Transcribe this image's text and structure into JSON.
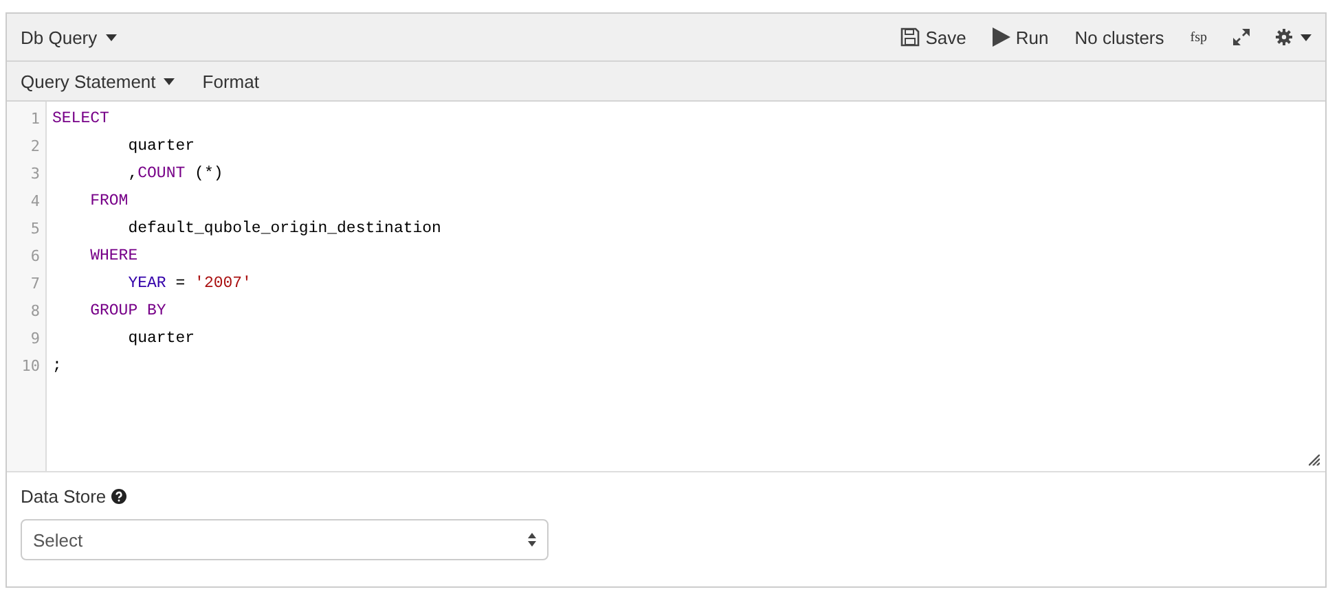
{
  "header": {
    "title": "Db Query",
    "actions": [
      {
        "kind": "save",
        "label": "Save"
      },
      {
        "kind": "run",
        "label": "Run"
      },
      {
        "kind": "text",
        "label": "No clusters"
      },
      {
        "kind": "small",
        "label": "fsp"
      },
      {
        "kind": "expand"
      },
      {
        "kind": "settings"
      }
    ]
  },
  "toolbar": {
    "menu": "Query Statement",
    "format": "Format"
  },
  "editor": {
    "lines": [
      {
        "number": "1",
        "tokens": [
          {
            "kind": "keyword",
            "text": "SELECT"
          }
        ]
      },
      {
        "number": "2",
        "tokens": [
          {
            "kind": "plain",
            "text": "        quarter"
          }
        ]
      },
      {
        "number": "3",
        "tokens": [
          {
            "kind": "plain",
            "text": "        ,"
          },
          {
            "kind": "keyword",
            "text": "COUNT"
          },
          {
            "kind": "plain",
            "text": " (*)"
          }
        ]
      },
      {
        "number": "4",
        "tokens": [
          {
            "kind": "keyword",
            "text": "    FROM"
          }
        ]
      },
      {
        "number": "5",
        "tokens": [
          {
            "kind": "plain",
            "text": "        default_qubole_origin_destination"
          }
        ]
      },
      {
        "number": "6",
        "tokens": [
          {
            "kind": "keyword",
            "text": "    WHERE"
          }
        ]
      },
      {
        "number": "7",
        "tokens": [
          {
            "kind": "builtin",
            "text": "        YEAR"
          },
          {
            "kind": "plain",
            "text": " = "
          },
          {
            "kind": "string",
            "text": "'2007'"
          }
        ]
      },
      {
        "number": "8",
        "tokens": [
          {
            "kind": "keyword",
            "text": "    GROUP BY"
          }
        ]
      },
      {
        "number": "9",
        "tokens": [
          {
            "kind": "plain",
            "text": "        quarter"
          }
        ]
      },
      {
        "number": "10",
        "tokens": [
          {
            "kind": "plain",
            "text": ";"
          }
        ]
      }
    ]
  },
  "data_store": {
    "label": "Data Store",
    "select": {
      "value": "Select"
    }
  }
}
